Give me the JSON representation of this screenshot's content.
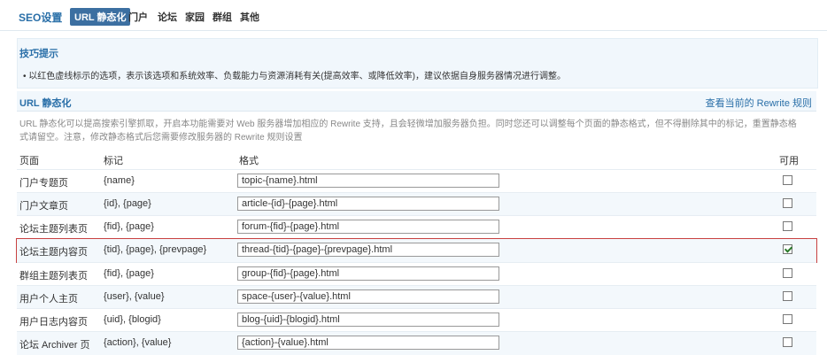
{
  "nav": {
    "title": "SEO设置",
    "tabs": [
      {
        "label": "URL 静态化",
        "active": true
      },
      {
        "label": "门户"
      },
      {
        "label": "论坛"
      },
      {
        "label": "家园"
      },
      {
        "label": "群组"
      },
      {
        "label": "其他"
      }
    ]
  },
  "tips": {
    "heading": "技巧提示",
    "text": "• 以红色虚线标示的选项，表示该选项和系统效率、负载能力与资源消耗有关(提高效率、或降低效率)，建议依据自身服务器情况进行调整。"
  },
  "section": {
    "title": "URL 静态化",
    "rewrite_link": "查看当前的 Rewrite 规则",
    "description": "URL 静态化可以提高搜索引擎抓取，开启本功能需要对 Web 服务器增加相应的 Rewrite 支持，且会轻微增加服务器负担。同时您还可以调整每个页面的静态格式，但不得删除其中的标记，重置静态格式请留空。注意，修改静态格式后您需要修改服务器的 Rewrite 规则设置"
  },
  "table": {
    "headers": {
      "page": "页面",
      "mark": "标记",
      "format": "格式",
      "enabled": "可用"
    },
    "rows": [
      {
        "page": "门户专题页",
        "mark": "{name}",
        "format": "topic-{name}.html",
        "enabled": false
      },
      {
        "page": "门户文章页",
        "mark": "{id}, {page}",
        "format": "article-{id}-{page}.html",
        "enabled": false
      },
      {
        "page": "论坛主题列表页",
        "mark": "{fid}, {page}",
        "format": "forum-{fid}-{page}.html",
        "enabled": false
      },
      {
        "page": "论坛主题内容页",
        "mark": "{tid}, {page}, {prevpage}",
        "format": "thread-{tid}-{page}-{prevpage}.html",
        "enabled": true
      },
      {
        "page": "群组主题列表页",
        "mark": "{fid}, {page}",
        "format": "group-{fid}-{page}.html",
        "enabled": false
      },
      {
        "page": "用户个人主页",
        "mark": "{user}, {value}",
        "format": "space-{user}-{value}.html",
        "enabled": false
      },
      {
        "page": "用户日志内容页",
        "mark": "{uid}, {blogid}",
        "format": "blog-{uid}-{blogid}.html",
        "enabled": false
      },
      {
        "page": "论坛 Archiver 页",
        "mark": "{action}, {value}",
        "format": "{action}-{value}.html",
        "enabled": false
      }
    ]
  }
}
